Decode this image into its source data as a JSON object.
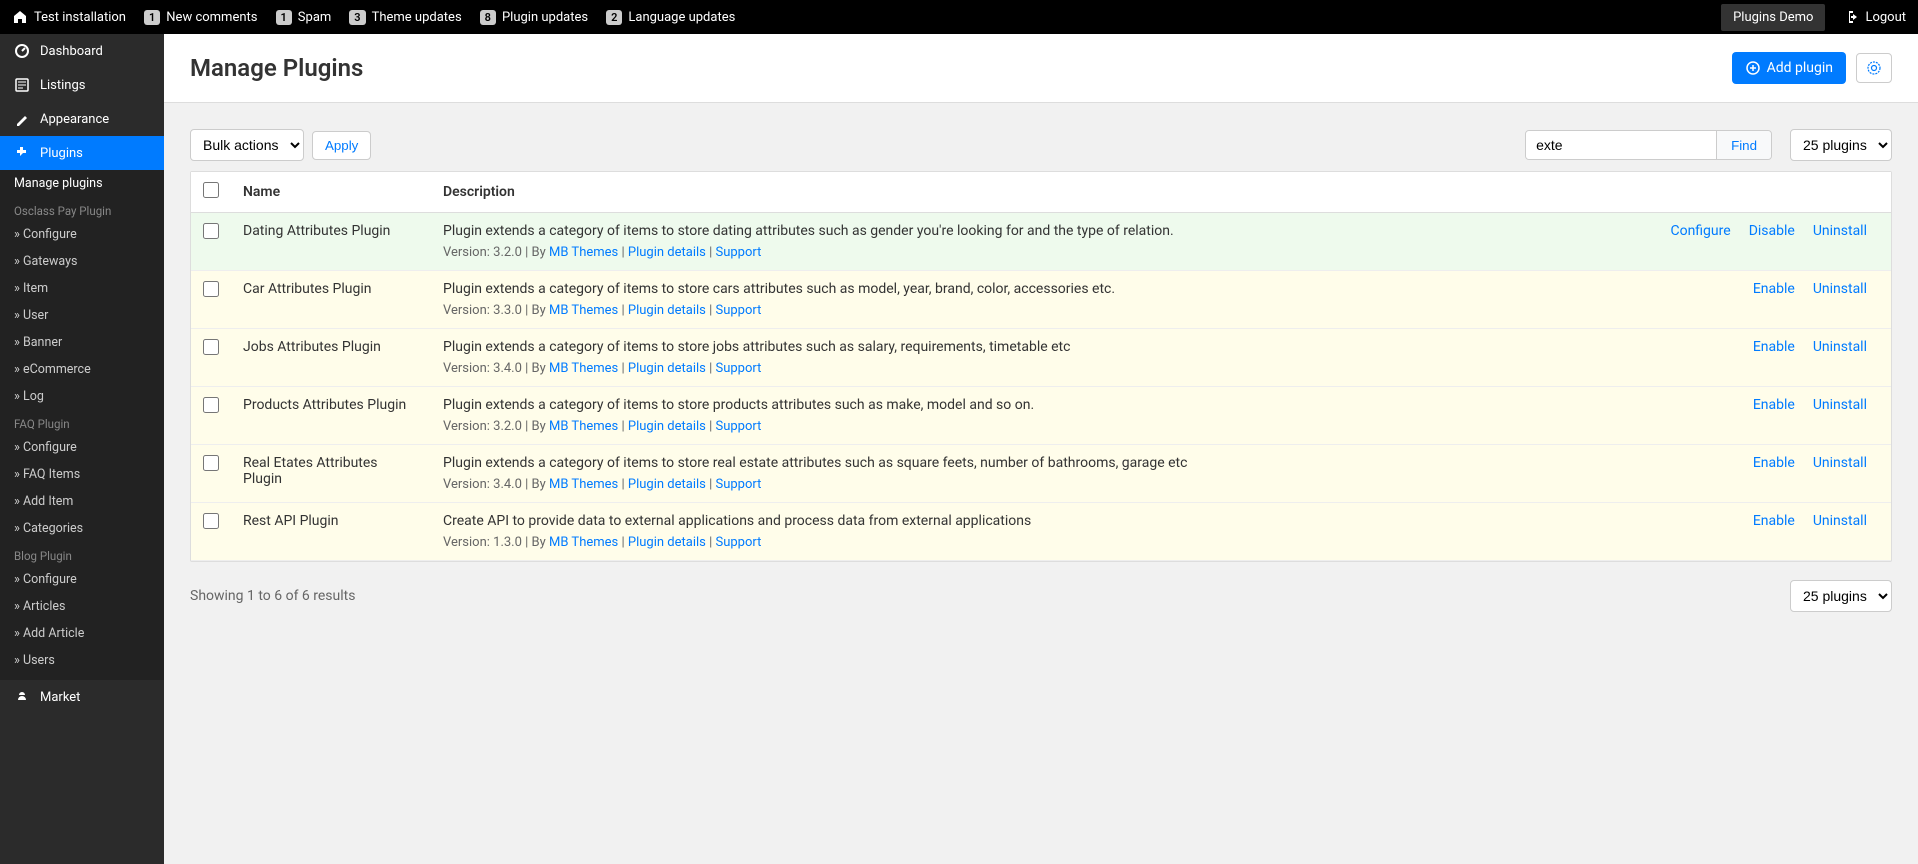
{
  "topbar": {
    "site": "Test installation",
    "notices": [
      {
        "count": "1",
        "label": "New comments"
      },
      {
        "count": "1",
        "label": "Spam"
      },
      {
        "count": "3",
        "label": "Theme updates"
      },
      {
        "count": "8",
        "label": "Plugin updates"
      },
      {
        "count": "2",
        "label": "Language updates"
      }
    ],
    "demo": "Plugins Demo",
    "logout": "Logout"
  },
  "sidebar": {
    "main": [
      {
        "label": "Dashboard"
      },
      {
        "label": "Listings"
      },
      {
        "label": "Appearance"
      },
      {
        "label": "Plugins",
        "active": true
      }
    ],
    "plugins_sub": {
      "manage": "Manage plugins",
      "groups": [
        {
          "head": "Osclass Pay Plugin",
          "items": [
            "Configure",
            "Gateways",
            "Item",
            "User",
            "Banner",
            "eCommerce",
            "Log"
          ]
        },
        {
          "head": "FAQ Plugin",
          "items": [
            "Configure",
            "FAQ Items",
            "Add Item",
            "Categories"
          ]
        },
        {
          "head": "Blog Plugin",
          "items": [
            "Configure",
            "Articles",
            "Add Article",
            "Users"
          ]
        }
      ]
    },
    "market": "Market"
  },
  "page": {
    "title": "Manage Plugins",
    "add_plugin": "Add plugin"
  },
  "toolbar": {
    "bulk": "Bulk actions",
    "apply": "Apply",
    "search_value": "exte",
    "find": "Find",
    "pagesize": "25 plugins"
  },
  "table": {
    "head": {
      "name": "Name",
      "desc": "Description"
    },
    "rows": [
      {
        "enabled": true,
        "name": "Dating Attributes Plugin",
        "desc": "Plugin extends a category of items to store dating attributes such as gender you're looking for and the type of relation.",
        "version": "3.2.0",
        "actions": [
          "Configure",
          "Disable",
          "Uninstall"
        ]
      },
      {
        "enabled": false,
        "name": "Car Attributes Plugin",
        "desc": "Plugin extends a category of items to store cars attributes such as model, year, brand, color, accessories etc.",
        "version": "3.3.0",
        "actions": [
          "Enable",
          "Uninstall"
        ]
      },
      {
        "enabled": false,
        "name": "Jobs Attributes Plugin",
        "desc": "Plugin extends a category of items to store jobs attributes such as salary, requirements, timetable etc",
        "version": "3.4.0",
        "actions": [
          "Enable",
          "Uninstall"
        ]
      },
      {
        "enabled": false,
        "name": "Products Attributes Plugin",
        "desc": "Plugin extends a category of items to store products attributes such as make, model and so on.",
        "version": "3.2.0",
        "actions": [
          "Enable",
          "Uninstall"
        ]
      },
      {
        "enabled": false,
        "name": "Real Etates Attributes Plugin",
        "desc": "Plugin extends a category of items to store real estate attributes such as square feets, number of bathrooms, garage etc",
        "version": "3.4.0",
        "actions": [
          "Enable",
          "Uninstall"
        ]
      },
      {
        "enabled": false,
        "name": "Rest API Plugin",
        "desc": "Create API to provide data to external applications and process data from external applications",
        "version": "1.3.0",
        "actions": [
          "Enable",
          "Uninstall"
        ]
      }
    ],
    "meta_labels": {
      "version_prefix": "Version: ",
      "by": " | By ",
      "author": "MB Themes",
      "sep": " | ",
      "details": "Plugin details",
      "support": "Support"
    }
  },
  "footer": {
    "summary": "Showing 1 to 6 of 6 results",
    "pagesize": "25 plugins"
  }
}
